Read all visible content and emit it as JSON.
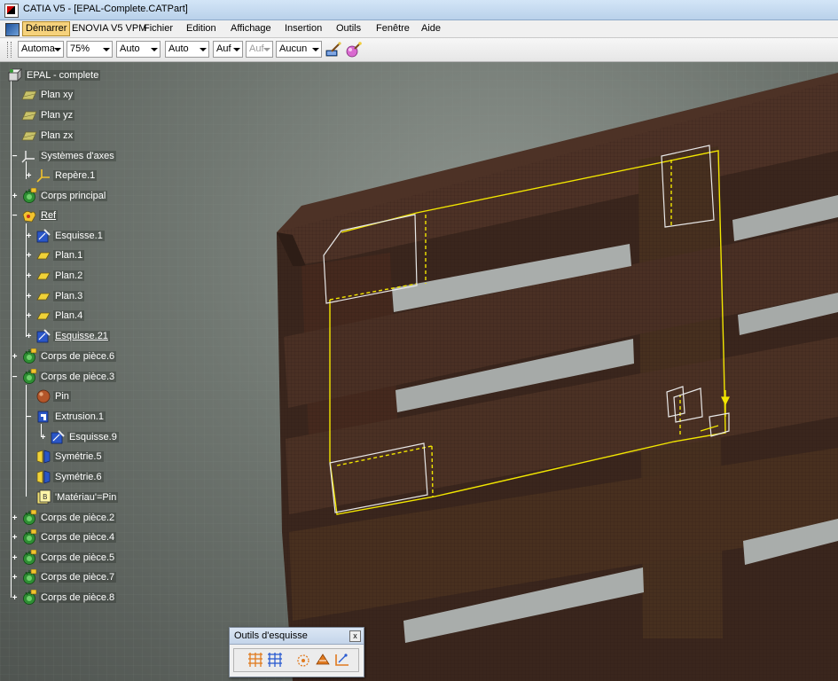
{
  "window": {
    "title": "CATIA V5 - [EPAL-Complete.CATPart]"
  },
  "menu": {
    "items": [
      "Démarrer",
      "ENOVIA V5 VPM",
      "Fichier",
      "Edition",
      "Affichage",
      "Insertion",
      "Outils",
      "Fenêtre",
      "Aide"
    ]
  },
  "toolbar": {
    "combos": [
      {
        "value": "Automa"
      },
      {
        "value": "75%"
      },
      {
        "value": "Auto"
      },
      {
        "value": "Auto"
      },
      {
        "value": "Auf"
      },
      {
        "value": "Auf"
      },
      {
        "value": "Aucun"
      }
    ],
    "icons": [
      "paint-brush-icon",
      "material-sphere-icon"
    ]
  },
  "tree": {
    "nodes": [
      {
        "label": "EPAL - complete",
        "icon": "part-icon"
      },
      {
        "label": "Plan xy",
        "icon": "plane-icon"
      },
      {
        "label": "Plan yz",
        "icon": "plane-icon"
      },
      {
        "label": "Plan zx",
        "icon": "plane-icon"
      },
      {
        "label": "Systèmes d'axes",
        "icon": "axis-system-icon"
      },
      {
        "label": "Repère.1",
        "icon": "axis-icon"
      },
      {
        "label": "Corps principal",
        "icon": "body-icon"
      },
      {
        "label": "Ref",
        "icon": "geometric-set-icon"
      },
      {
        "label": "Esquisse.1",
        "icon": "sketch-icon"
      },
      {
        "label": "Plan.1",
        "icon": "small-plane-icon"
      },
      {
        "label": "Plan.2",
        "icon": "small-plane-icon"
      },
      {
        "label": "Plan.3",
        "icon": "small-plane-icon"
      },
      {
        "label": "Plan.4",
        "icon": "small-plane-icon"
      },
      {
        "label": "Esquisse.21",
        "icon": "sketch-icon"
      },
      {
        "label": "Corps de pièce.6",
        "icon": "body-icon"
      },
      {
        "label": "Corps de pièce.3",
        "icon": "body-icon"
      },
      {
        "label": "Pin",
        "icon": "material-icon"
      },
      {
        "label": "Extrusion.1",
        "icon": "pad-icon"
      },
      {
        "label": "Esquisse.9",
        "icon": "sketch-icon"
      },
      {
        "label": "Symétrie.5",
        "icon": "symmetry-icon"
      },
      {
        "label": "Symétrie.6",
        "icon": "symmetry-icon"
      },
      {
        "label": "'Matériau'=Pin",
        "icon": "parameter-icon"
      },
      {
        "label": "Corps de pièce.2",
        "icon": "body-icon"
      },
      {
        "label": "Corps de pièce.4",
        "icon": "body-icon"
      },
      {
        "label": "Corps de pièce.5",
        "icon": "body-icon"
      },
      {
        "label": "Corps de pièce.7",
        "icon": "body-icon"
      },
      {
        "label": "Corps de pièce.8",
        "icon": "body-icon"
      }
    ]
  },
  "palette": {
    "title": "Outils d'esquisse",
    "close": "x",
    "icons": [
      "grid-icon",
      "snap-to-point-icon",
      "construction-element-icon",
      "geometric-constraint-icon",
      "dimensional-constraint-icon"
    ]
  },
  "colors": {
    "wood": "#4a3024",
    "wood_dark": "#33221a",
    "sketch": "#f2e600",
    "background": "#6f7670",
    "tree_line": "#ffffff",
    "menu_active": "#f6d27c"
  }
}
